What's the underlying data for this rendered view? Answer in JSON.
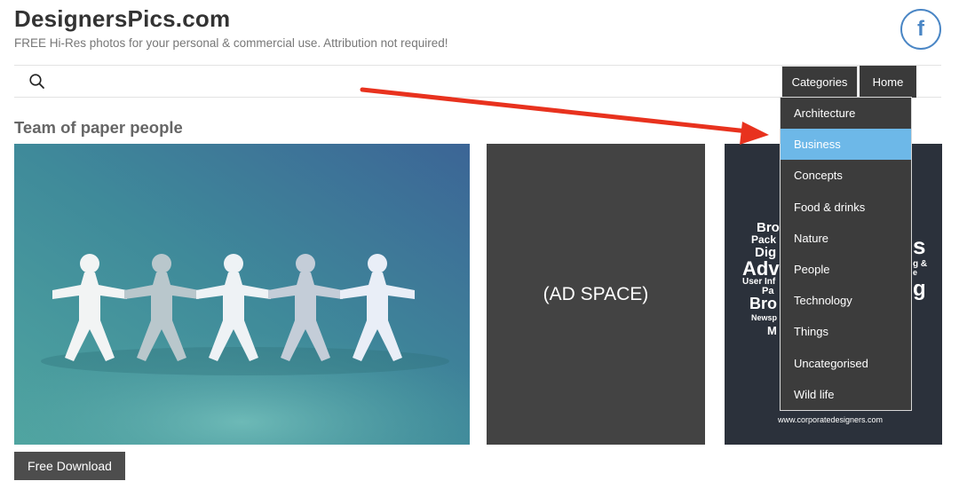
{
  "site": {
    "title": "DesignersPics.com",
    "tagline": "FREE Hi-Res photos for your personal & commercial use. Attribution not required!",
    "social_icon": "facebook-icon",
    "social_glyph": "f"
  },
  "nav": {
    "search_icon": "search-icon",
    "categories_label": "Categories",
    "home_label": "Home",
    "dropdown_items": [
      {
        "label": "Architecture"
      },
      {
        "label": "Business",
        "active": true
      },
      {
        "label": "Concepts"
      },
      {
        "label": "Food & drinks"
      },
      {
        "label": "Nature"
      },
      {
        "label": "People"
      },
      {
        "label": "Technology"
      },
      {
        "label": "Things"
      },
      {
        "label": "Uncategorised"
      },
      {
        "label": "Wild life"
      }
    ]
  },
  "post": {
    "title": "Team of paper people",
    "ad_label": "(AD SPACE)",
    "thumb_words": [
      "Bro",
      "Pack",
      "Dig",
      "Adv",
      "User Inf",
      "Pa",
      "Bro",
      "Newsp",
      "M",
      "s",
      "g &",
      "e",
      "g"
    ],
    "thumb_url": "www.corporatedesigners.com",
    "download_label": "Free Download"
  },
  "colors": {
    "accent_active": "#6db8e8",
    "nav_dark": "#3a3a3a",
    "facebook_blue": "#4a86c5",
    "arrow_red": "#e8321e"
  }
}
